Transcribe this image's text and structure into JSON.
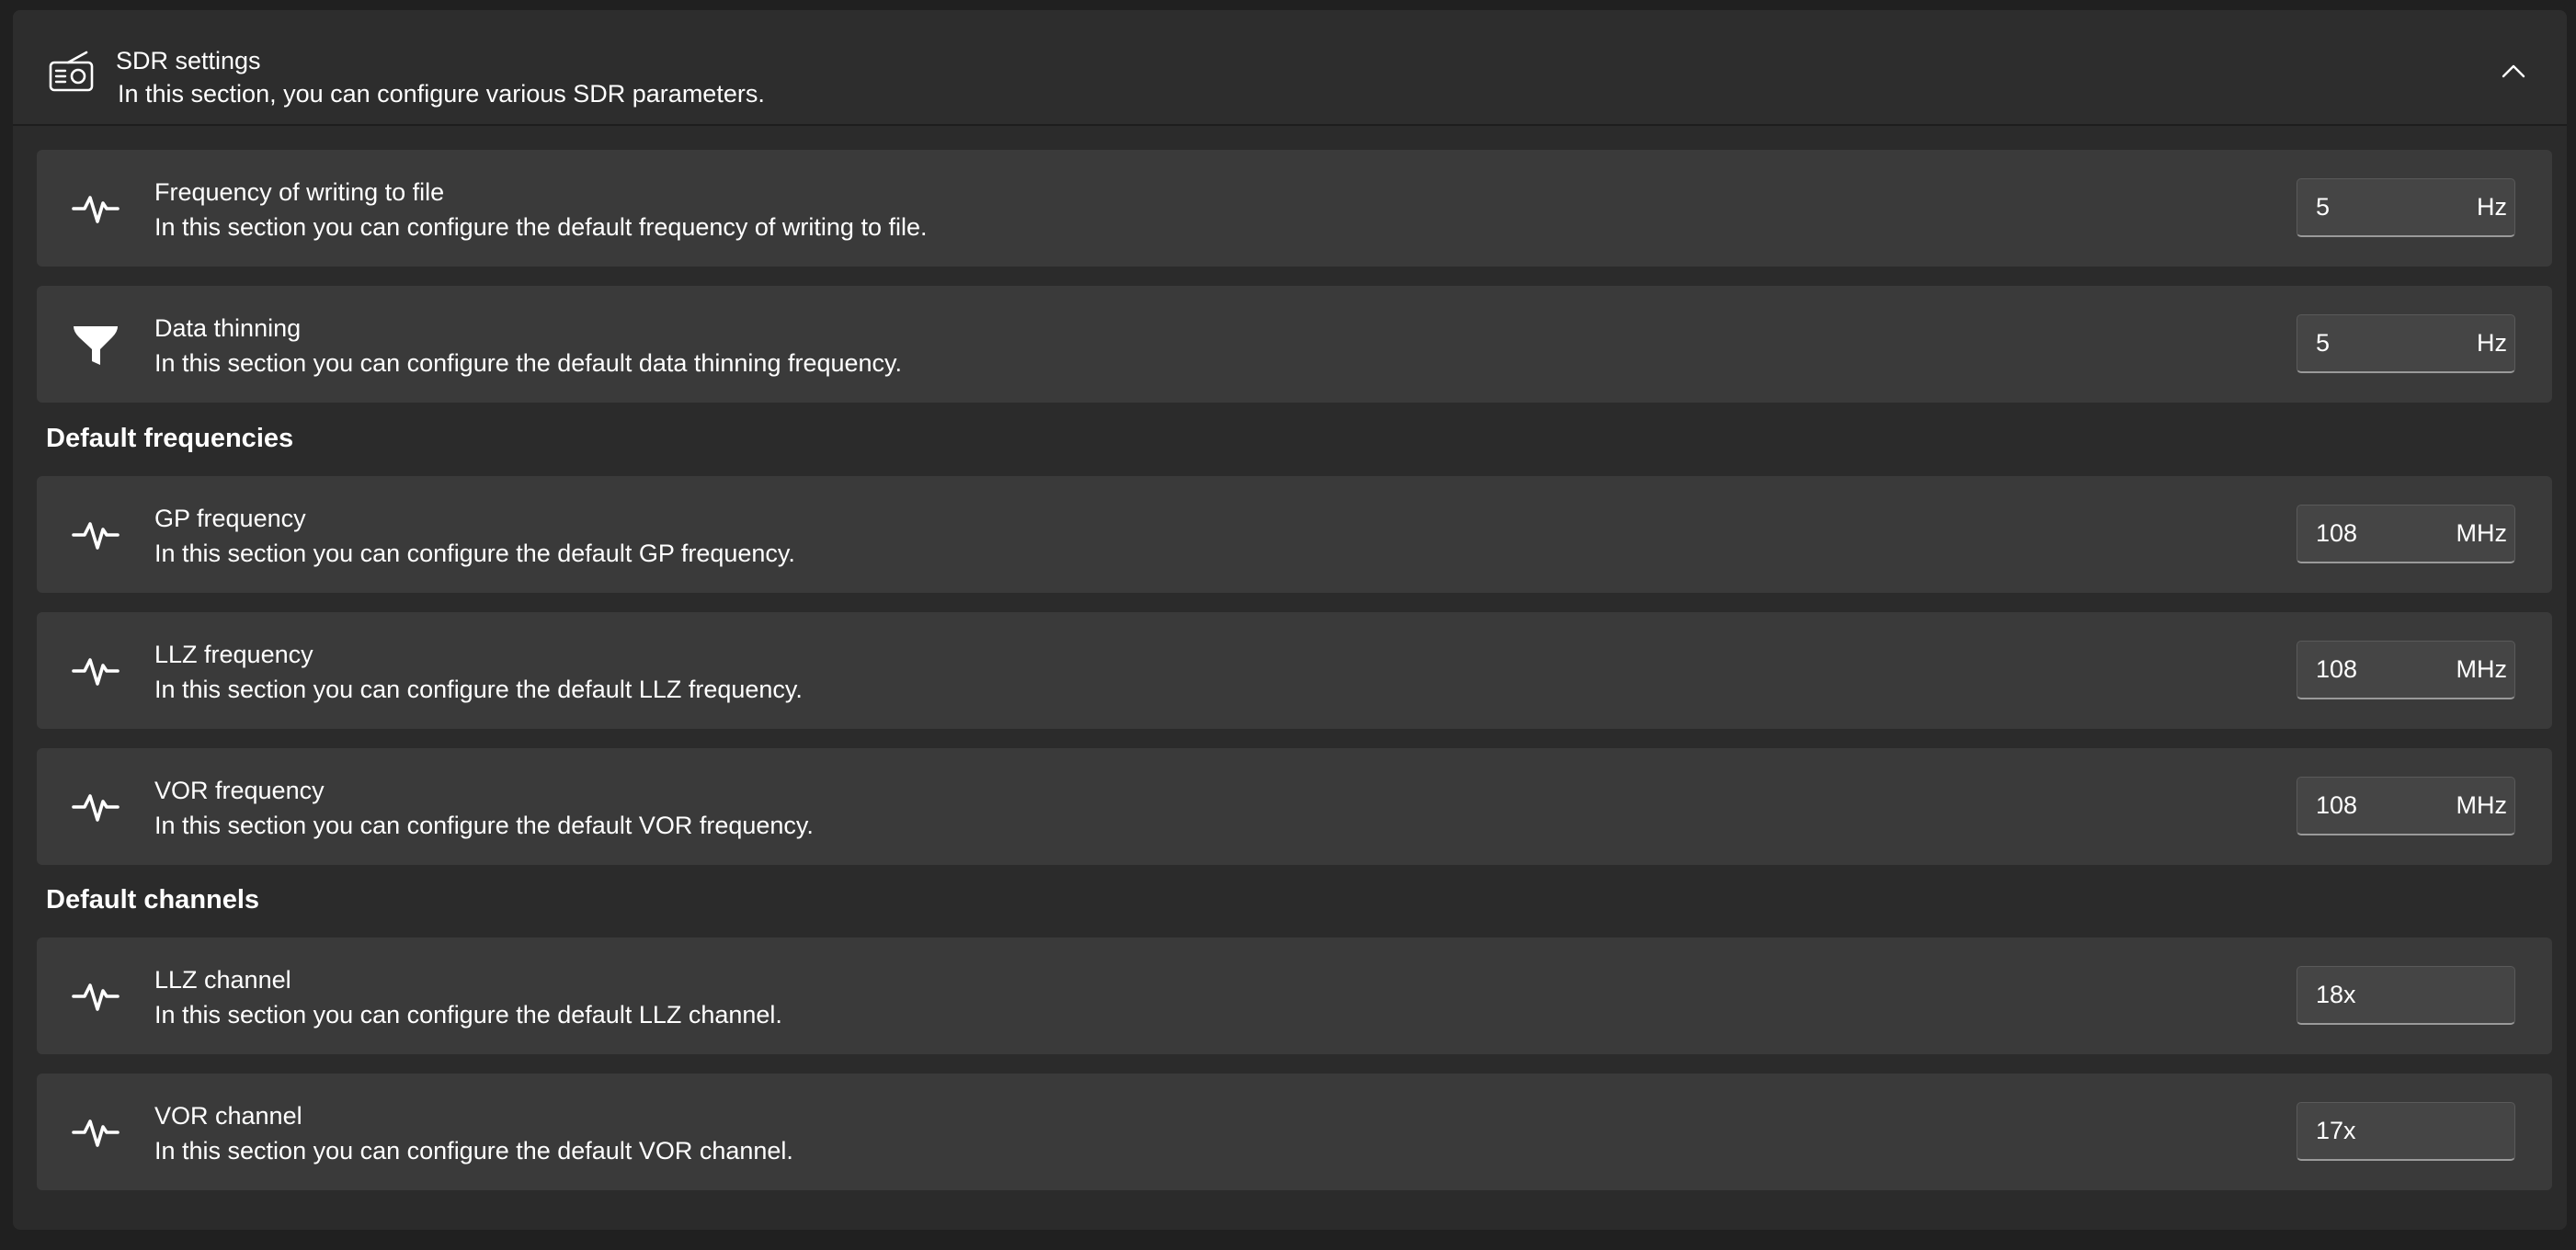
{
  "header": {
    "title": "SDR settings",
    "description": "In this section, you can configure various SDR parameters.",
    "icon": "radio-icon",
    "collapse_icon": "chevron-up-icon"
  },
  "general": [
    {
      "title": "Frequency of writing to file",
      "description": "In this section you can configure the default frequency of writing to file.",
      "icon": "pulse-icon",
      "value": "5",
      "unit": "Hz"
    },
    {
      "title": "Data thinning",
      "description": "In this section you can configure the default data thinning frequency.",
      "icon": "filter-icon",
      "value": "5",
      "unit": "Hz"
    }
  ],
  "default_frequencies": {
    "label": "Default frequencies",
    "items": [
      {
        "title": "GP frequency",
        "description": "In this section you can configure the default GP frequency.",
        "icon": "pulse-icon",
        "value": "108",
        "unit": "MHz"
      },
      {
        "title": "LLZ frequency",
        "description": "In this section you can configure the default LLZ frequency.",
        "icon": "pulse-icon",
        "value": "108",
        "unit": "MHz"
      },
      {
        "title": "VOR frequency",
        "description": "In this section you can configure the default VOR frequency.",
        "icon": "pulse-icon",
        "value": "108",
        "unit": "MHz"
      }
    ]
  },
  "default_channels": {
    "label": "Default channels",
    "items": [
      {
        "title": "LLZ channel",
        "description": "In this section you can configure the default LLZ channel.",
        "icon": "pulse-icon",
        "value": "18x"
      },
      {
        "title": "VOR channel",
        "description": "In this section you can configure the default VOR channel.",
        "icon": "pulse-icon",
        "value": "17x"
      }
    ]
  },
  "colors": {
    "page_background": "#202020",
    "panel_background": "#2b2b2b",
    "card_background": "#3a3a3a",
    "input_background": "#454545",
    "text": "#ffffff"
  }
}
